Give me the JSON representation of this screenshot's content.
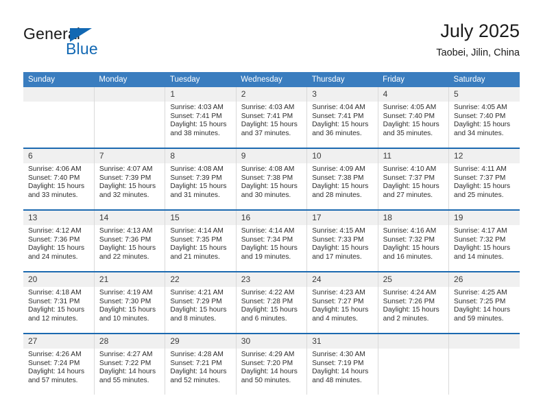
{
  "brand": {
    "name_dark": "General",
    "name_blue": "Blue",
    "accent_color": "#1268b3"
  },
  "header": {
    "title": "July 2025",
    "location": "Taobei, Jilin, China",
    "header_bg": "#3a7dbf",
    "separator_color": "#1b69b0",
    "date_band_color": "#f0f0f0"
  },
  "weekday_headers": [
    "Sunday",
    "Monday",
    "Tuesday",
    "Wednesday",
    "Thursday",
    "Friday",
    "Saturday"
  ],
  "weeks": [
    [
      {
        "day": "",
        "sunrise": "",
        "sunset": "",
        "daylight": ""
      },
      {
        "day": "",
        "sunrise": "",
        "sunset": "",
        "daylight": ""
      },
      {
        "day": "1",
        "sunrise": "Sunrise: 4:03 AM",
        "sunset": "Sunset: 7:41 PM",
        "daylight": "Daylight: 15 hours and 38 minutes."
      },
      {
        "day": "2",
        "sunrise": "Sunrise: 4:03 AM",
        "sunset": "Sunset: 7:41 PM",
        "daylight": "Daylight: 15 hours and 37 minutes."
      },
      {
        "day": "3",
        "sunrise": "Sunrise: 4:04 AM",
        "sunset": "Sunset: 7:41 PM",
        "daylight": "Daylight: 15 hours and 36 minutes."
      },
      {
        "day": "4",
        "sunrise": "Sunrise: 4:05 AM",
        "sunset": "Sunset: 7:40 PM",
        "daylight": "Daylight: 15 hours and 35 minutes."
      },
      {
        "day": "5",
        "sunrise": "Sunrise: 4:05 AM",
        "sunset": "Sunset: 7:40 PM",
        "daylight": "Daylight: 15 hours and 34 minutes."
      }
    ],
    [
      {
        "day": "6",
        "sunrise": "Sunrise: 4:06 AM",
        "sunset": "Sunset: 7:40 PM",
        "daylight": "Daylight: 15 hours and 33 minutes."
      },
      {
        "day": "7",
        "sunrise": "Sunrise: 4:07 AM",
        "sunset": "Sunset: 7:39 PM",
        "daylight": "Daylight: 15 hours and 32 minutes."
      },
      {
        "day": "8",
        "sunrise": "Sunrise: 4:08 AM",
        "sunset": "Sunset: 7:39 PM",
        "daylight": "Daylight: 15 hours and 31 minutes."
      },
      {
        "day": "9",
        "sunrise": "Sunrise: 4:08 AM",
        "sunset": "Sunset: 7:38 PM",
        "daylight": "Daylight: 15 hours and 30 minutes."
      },
      {
        "day": "10",
        "sunrise": "Sunrise: 4:09 AM",
        "sunset": "Sunset: 7:38 PM",
        "daylight": "Daylight: 15 hours and 28 minutes."
      },
      {
        "day": "11",
        "sunrise": "Sunrise: 4:10 AM",
        "sunset": "Sunset: 7:37 PM",
        "daylight": "Daylight: 15 hours and 27 minutes."
      },
      {
        "day": "12",
        "sunrise": "Sunrise: 4:11 AM",
        "sunset": "Sunset: 7:37 PM",
        "daylight": "Daylight: 15 hours and 25 minutes."
      }
    ],
    [
      {
        "day": "13",
        "sunrise": "Sunrise: 4:12 AM",
        "sunset": "Sunset: 7:36 PM",
        "daylight": "Daylight: 15 hours and 24 minutes."
      },
      {
        "day": "14",
        "sunrise": "Sunrise: 4:13 AM",
        "sunset": "Sunset: 7:36 PM",
        "daylight": "Daylight: 15 hours and 22 minutes."
      },
      {
        "day": "15",
        "sunrise": "Sunrise: 4:14 AM",
        "sunset": "Sunset: 7:35 PM",
        "daylight": "Daylight: 15 hours and 21 minutes."
      },
      {
        "day": "16",
        "sunrise": "Sunrise: 4:14 AM",
        "sunset": "Sunset: 7:34 PM",
        "daylight": "Daylight: 15 hours and 19 minutes."
      },
      {
        "day": "17",
        "sunrise": "Sunrise: 4:15 AM",
        "sunset": "Sunset: 7:33 PM",
        "daylight": "Daylight: 15 hours and 17 minutes."
      },
      {
        "day": "18",
        "sunrise": "Sunrise: 4:16 AM",
        "sunset": "Sunset: 7:32 PM",
        "daylight": "Daylight: 15 hours and 16 minutes."
      },
      {
        "day": "19",
        "sunrise": "Sunrise: 4:17 AM",
        "sunset": "Sunset: 7:32 PM",
        "daylight": "Daylight: 15 hours and 14 minutes."
      }
    ],
    [
      {
        "day": "20",
        "sunrise": "Sunrise: 4:18 AM",
        "sunset": "Sunset: 7:31 PM",
        "daylight": "Daylight: 15 hours and 12 minutes."
      },
      {
        "day": "21",
        "sunrise": "Sunrise: 4:19 AM",
        "sunset": "Sunset: 7:30 PM",
        "daylight": "Daylight: 15 hours and 10 minutes."
      },
      {
        "day": "22",
        "sunrise": "Sunrise: 4:21 AM",
        "sunset": "Sunset: 7:29 PM",
        "daylight": "Daylight: 15 hours and 8 minutes."
      },
      {
        "day": "23",
        "sunrise": "Sunrise: 4:22 AM",
        "sunset": "Sunset: 7:28 PM",
        "daylight": "Daylight: 15 hours and 6 minutes."
      },
      {
        "day": "24",
        "sunrise": "Sunrise: 4:23 AM",
        "sunset": "Sunset: 7:27 PM",
        "daylight": "Daylight: 15 hours and 4 minutes."
      },
      {
        "day": "25",
        "sunrise": "Sunrise: 4:24 AM",
        "sunset": "Sunset: 7:26 PM",
        "daylight": "Daylight: 15 hours and 2 minutes."
      },
      {
        "day": "26",
        "sunrise": "Sunrise: 4:25 AM",
        "sunset": "Sunset: 7:25 PM",
        "daylight": "Daylight: 14 hours and 59 minutes."
      }
    ],
    [
      {
        "day": "27",
        "sunrise": "Sunrise: 4:26 AM",
        "sunset": "Sunset: 7:24 PM",
        "daylight": "Daylight: 14 hours and 57 minutes."
      },
      {
        "day": "28",
        "sunrise": "Sunrise: 4:27 AM",
        "sunset": "Sunset: 7:22 PM",
        "daylight": "Daylight: 14 hours and 55 minutes."
      },
      {
        "day": "29",
        "sunrise": "Sunrise: 4:28 AM",
        "sunset": "Sunset: 7:21 PM",
        "daylight": "Daylight: 14 hours and 52 minutes."
      },
      {
        "day": "30",
        "sunrise": "Sunrise: 4:29 AM",
        "sunset": "Sunset: 7:20 PM",
        "daylight": "Daylight: 14 hours and 50 minutes."
      },
      {
        "day": "31",
        "sunrise": "Sunrise: 4:30 AM",
        "sunset": "Sunset: 7:19 PM",
        "daylight": "Daylight: 14 hours and 48 minutes."
      },
      {
        "day": "",
        "sunrise": "",
        "sunset": "",
        "daylight": ""
      },
      {
        "day": "",
        "sunrise": "",
        "sunset": "",
        "daylight": ""
      }
    ]
  ]
}
